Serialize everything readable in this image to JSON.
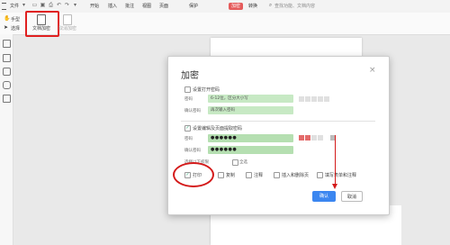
{
  "menubar": {
    "file_label": "文件",
    "tabs": [
      "开始",
      "插入",
      "批注",
      "视图",
      "页面",
      "保护",
      "转换"
    ],
    "active_tab": "加密",
    "search_placeholder": "查找功能、文档内容"
  },
  "toolbar": {
    "hand_label": "手型",
    "select_label": "选择",
    "encrypt_doc_label": "文档加密",
    "remove_encrypt_label": "取消加密"
  },
  "dialog": {
    "title": "加密",
    "close": "×",
    "open_pwd_section": "设置打开密码",
    "open_pwd_label": "密码",
    "open_pwd_placeholder": "6-12位，区分大小写",
    "open_confirm_label": "确认密码",
    "open_confirm_placeholder": "再次输入密码",
    "edit_pwd_section": "设置编辑及页面提取密码",
    "edit_pwd_label": "密码",
    "edit_pwd_value": "●●●●●●",
    "edit_confirm_label": "确认密码",
    "edit_confirm_value": "●●●●●●",
    "permissions_label": "选择以下权限",
    "select_all_label": "全选",
    "perm_print": "打印",
    "perm_copy": "复制",
    "perm_annotate": "注释",
    "perm_insert": "插入和删除页",
    "perm_form": "填写表单和注释",
    "ok_label": "确认",
    "cancel_label": "取消"
  },
  "colors": {
    "accent": "#3b86f0",
    "encrypt_tab": "#e55b5b",
    "field_green": "#c7e9c4",
    "annotation_red": "#d41a1a"
  }
}
